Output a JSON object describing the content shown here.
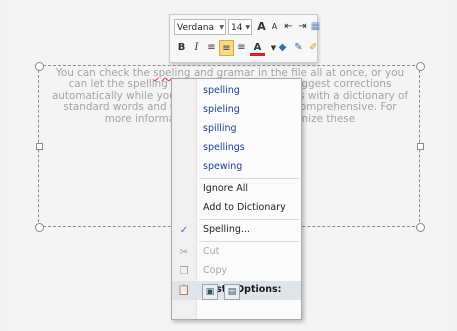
{
  "toolbar": {
    "font_name": "Verdana",
    "font_size": "14",
    "grow_font_glyph": "A",
    "shrink_font_glyph": "A",
    "bold_label": "B",
    "italic_label": "I",
    "font_color_glyph": "A"
  },
  "document": {
    "text_before": "You can check the ",
    "text_misspelled": "speling",
    "text_after": " and gramar in the file all at once, or you can let the spelling and grammar checker suggest corrections automatically while you work. Word 2010 comes with a dictionary of standard words and terms, but they are not comprehensive. For more information about how to customize these"
  },
  "context_menu": {
    "suggestions": [
      "spelling",
      "spieling",
      "spilling",
      "spellings",
      "spewing"
    ],
    "ignore_all": "Ignore All",
    "add_to_dictionary": "Add to Dictionary",
    "spelling": "Spelling...",
    "cut": "Cut",
    "copy": "Copy",
    "paste_options_header": "Paste Options:"
  },
  "colors": {
    "accent": "#f7d98b",
    "menu_text": "#1d3f85",
    "font_color_underline": "#e02020"
  }
}
